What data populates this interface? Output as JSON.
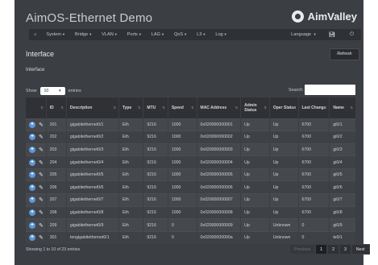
{
  "app": {
    "title": "AimOS-Ethernet Demo",
    "brand": "AimValley"
  },
  "navbar": {
    "home_icon": "home-icon",
    "items": [
      "System",
      "Bridge",
      "VLAN",
      "Ports",
      "LAG",
      "QoS",
      "L3",
      "Log"
    ],
    "language": "Language",
    "save_icon": "save-icon",
    "power_icon": "power-icon"
  },
  "page": {
    "title": "Interface",
    "refresh": "Refresh",
    "subtitle": "Interface"
  },
  "table_controls": {
    "show_label": "Show",
    "page_size": "10",
    "entries_label": "entries",
    "search_label": "Search:"
  },
  "columns": [
    "ID",
    "Description",
    "Type",
    "MTU",
    "Speed",
    "MAC Address",
    "Admin Status",
    "Oper Status",
    "Last Change",
    "Name"
  ],
  "rows": [
    [
      "201",
      "gigabitethernet0/1",
      "Eth",
      "9216",
      "1000",
      "0x020000000001",
      "Up",
      "Up",
      "6700",
      "gi0/1"
    ],
    [
      "202",
      "gigabitethernet0/2",
      "Eth",
      "9216",
      "1000",
      "0x020000000002",
      "Up",
      "Up",
      "6700",
      "gi0/2"
    ],
    [
      "203",
      "gigabitethernet0/3",
      "Eth",
      "9216",
      "1000",
      "0x020000000003",
      "Up",
      "Up",
      "6700",
      "gi0/3"
    ],
    [
      "204",
      "gigabitethernet0/4",
      "Eth",
      "9216",
      "1000",
      "0x020000000004",
      "Up",
      "Up",
      "6700",
      "gi0/4"
    ],
    [
      "205",
      "gigabitethernet0/5",
      "Eth",
      "9216",
      "1000",
      "0x020000000005",
      "Up",
      "Up",
      "6700",
      "gi0/5"
    ],
    [
      "206",
      "gigabitethernet0/6",
      "Eth",
      "9216",
      "1000",
      "0x020000000006",
      "Up",
      "Up",
      "6700",
      "gi0/6"
    ],
    [
      "207",
      "gigabitethernet0/7",
      "Eth",
      "9216",
      "1000",
      "0x020000000007",
      "Up",
      "Up",
      "6700",
      "gi0/7"
    ],
    [
      "208",
      "gigabitethernet0/8",
      "Eth",
      "9216",
      "1000",
      "0x020000000008",
      "Up",
      "Up",
      "6700",
      "gi0/8"
    ],
    [
      "209",
      "gigabitethernet0/9",
      "Eth",
      "9216",
      "0",
      "0x020000000009",
      "Up",
      "Unknown",
      "0",
      "gi0/9"
    ],
    [
      "301",
      "tengigabitethernet0/1",
      "Eth",
      "9216",
      "0",
      "0x02000000000a",
      "Up",
      "Unknown",
      "0",
      "te0/1"
    ]
  ],
  "footer": {
    "info": "Showing 1 to 10 of 23 entries",
    "previous": "Previous",
    "pages": [
      "1",
      "2",
      "3"
    ],
    "current_page": "1",
    "next": "Next"
  },
  "colors": {
    "frame": "#3b3e43",
    "navbar": "#2f3135",
    "accent": "#5c95d6"
  }
}
